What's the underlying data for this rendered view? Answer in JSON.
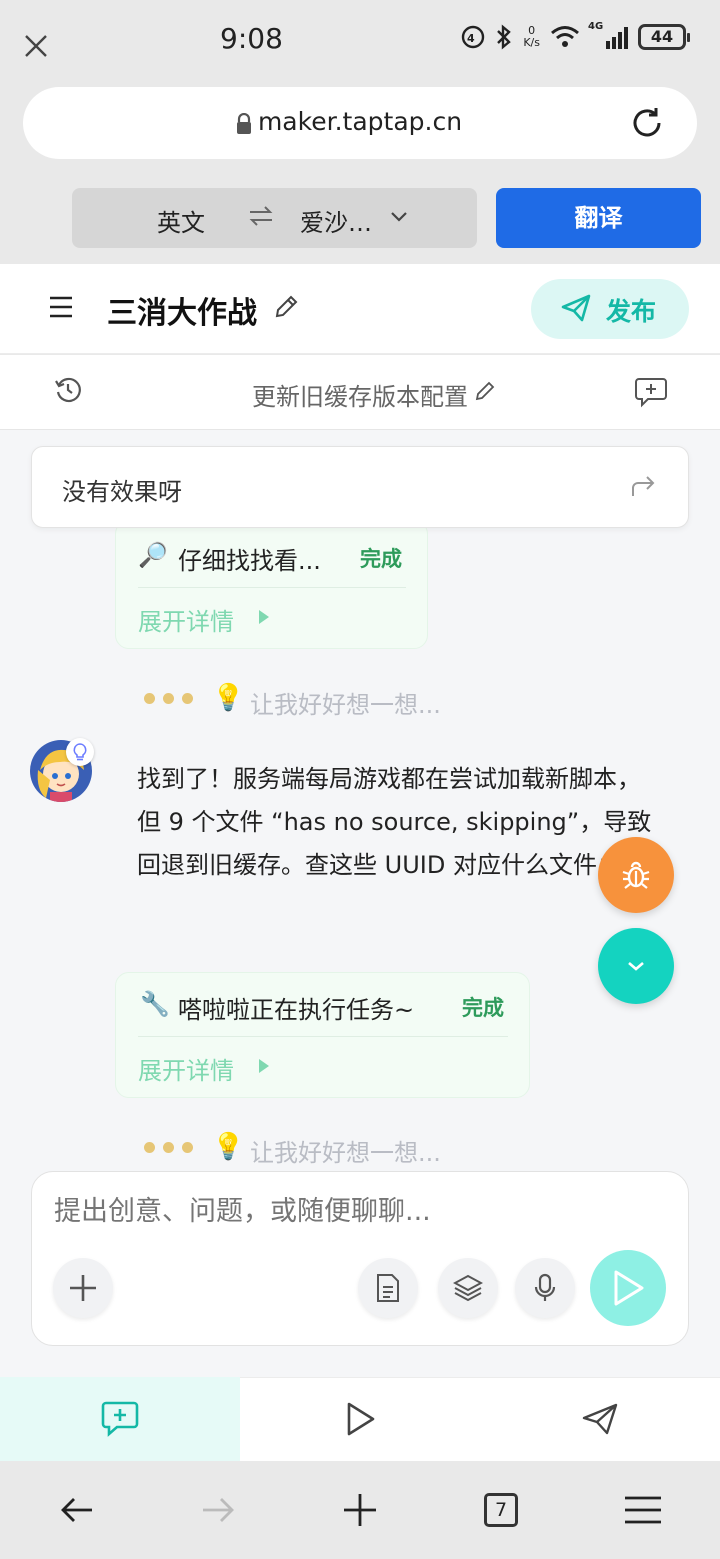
{
  "status_bar": {
    "time": "9:08",
    "net_speed_value": "0",
    "net_speed_unit": "K/s",
    "network": "4G",
    "battery": "44"
  },
  "browser": {
    "url": "maker.taptap.cn",
    "translate": {
      "source_lang": "英文",
      "target_lang": "爱沙…",
      "button": "翻译"
    },
    "tabs_count": "7"
  },
  "app": {
    "title": "三消大作战",
    "publish_label": "发布",
    "session_title": "更新旧缓存版本配置",
    "accent": "#14b8a6"
  },
  "chat": {
    "quoted_message": "没有效果呀",
    "task1": {
      "emoji": "🔎",
      "title": "仔细找找看...",
      "status": "完成",
      "expand": "展开详情"
    },
    "thinking1": {
      "bulb": "💡",
      "text": "让我好好想一想..."
    },
    "ai_message": "找到了！服务端每局游戏都在尝试加载新脚本，但 9 个文件 “has no source, skipping”，导致回退到旧缓存。查这些 UUID 对应什么文件：",
    "task2": {
      "emoji": "🔧",
      "title": "嗒啦啦正在执行任务~",
      "status": "完成",
      "expand": "展开详情"
    },
    "thinking2": {
      "bulb": "💡",
      "text": "让我好好想一想..."
    }
  },
  "composer": {
    "placeholder": "提出创意、问题，或随便聊聊..."
  }
}
